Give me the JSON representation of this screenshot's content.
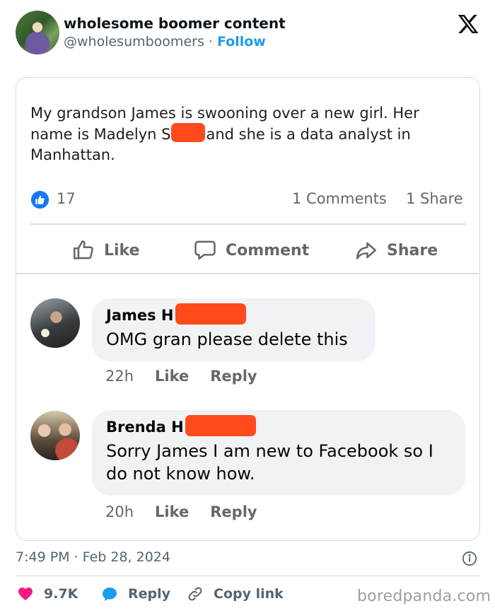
{
  "tweet": {
    "author_name": "wholesome boomer content",
    "handle": "@wholesumboomers",
    "separator": " · ",
    "follow_label": "Follow",
    "timestamp": "7:49 PM · Feb 28, 2024"
  },
  "fb_post": {
    "text_part1": "My grandson James is swooning over a new girl. Her name is Madelyn S",
    "text_part2": "and she is a data analyst in Manhattan.",
    "like_count": "17",
    "comments_label": "1 Comments",
    "shares_label": "1 Share",
    "actions": {
      "like": "Like",
      "comment": "Comment",
      "share": "Share"
    }
  },
  "comments": [
    {
      "name": "James H",
      "text": "OMG gran please delete this",
      "time": "22h",
      "like": "Like",
      "reply": "Reply"
    },
    {
      "name": "Brenda H",
      "text": "Sorry James I am new to Facebook so I do not know how.",
      "time": "20h",
      "like": "Like",
      "reply": "Reply"
    }
  ],
  "footer": {
    "likes": "9.7K",
    "reply_label": "Reply",
    "copy_label": "Copy link",
    "watermark": "boredpanda.com"
  },
  "colors": {
    "link_blue": "#1d9bf0",
    "fb_blue": "#1877f2",
    "heart": "#f91880",
    "redaction": "#ff4a1c"
  },
  "icons": [
    "x-logo-icon",
    "thumbs-up-icon",
    "comment-icon",
    "share-arrow-icon",
    "info-icon",
    "heart-icon",
    "reply-bubble-icon",
    "link-icon"
  ]
}
